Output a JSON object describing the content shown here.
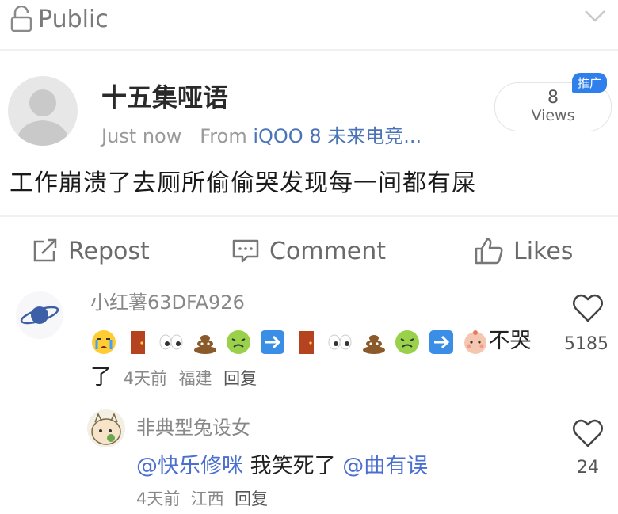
{
  "top_bar": {
    "visibility_label": "Public"
  },
  "post": {
    "author": "十五集哑语",
    "time": "Just now",
    "source_prefix": "From",
    "source": "iQOO 8 未来电竞...",
    "views_count": "8",
    "views_label": "Views",
    "ad_badge": "推广",
    "text": "工作崩溃了去厕所偷偷哭发现每一间都有屎"
  },
  "actions": {
    "repost": "Repost",
    "comment": "Comment",
    "likes": "Likes"
  },
  "comments": [
    {
      "username": "小红薯63DFA926",
      "text_tail": "不哭",
      "text_wrap": "了",
      "meta_time": "4天前",
      "meta_location": "福建",
      "meta_reply": "回复",
      "likes": "5185",
      "emojis": [
        "crying-face",
        "door",
        "eyes",
        "poop",
        "nauseated-face",
        "right-arrow",
        "door",
        "eyes",
        "poop",
        "nauseated-face",
        "right-arrow",
        "baby-face"
      ]
    }
  ],
  "reply": {
    "username": "非典型兔设女",
    "mention1": "@快乐修咪",
    "text": " 我笑死了",
    "mention2": "@曲有误",
    "meta_time": "4天前",
    "meta_location": "江西",
    "meta_reply": "回复",
    "likes": "24"
  }
}
